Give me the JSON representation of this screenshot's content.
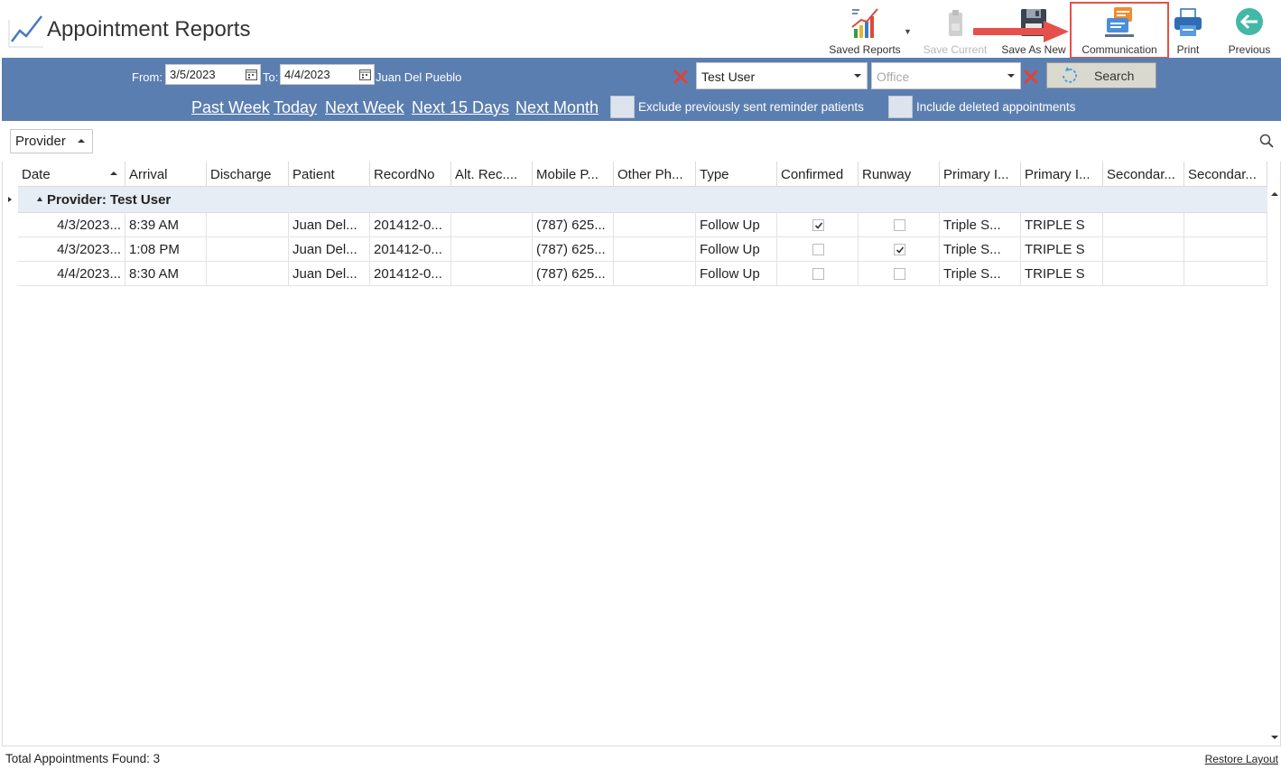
{
  "app": {
    "title": "Appointment Reports"
  },
  "toolbar": {
    "saved_reports": "Saved Reports",
    "save_current": "Save Current",
    "save_as_new": "Save As New",
    "communication": "Communication",
    "print": "Print",
    "previous": "Previous"
  },
  "filters": {
    "from_label": "From:",
    "from_value": "3/5/2023",
    "to_label": "To:",
    "to_value": "4/4/2023",
    "patient_name": "Juan Del Pueblo",
    "provider_value": "Test User",
    "office_placeholder": "Office",
    "search_label": "Search",
    "quick_links": [
      "Past Week",
      "Today",
      "Next Week",
      "Next 15 Days",
      "Next Month"
    ],
    "exclude_label": "Exclude previously sent reminder patients",
    "include_deleted_label": "Include deleted appointments"
  },
  "group_by": {
    "value": "Provider"
  },
  "grid": {
    "columns": [
      "Date",
      "Arrival",
      "Discharge",
      "Patient",
      "RecordNo",
      "Alt. Rec....",
      "Mobile P...",
      "Other Ph...",
      "Type",
      "Confirmed",
      "Runway",
      "Primary I...",
      "Primary I...",
      "Secondar...",
      "Secondar..."
    ],
    "group_label": "Provider: Test User",
    "rows": [
      {
        "date": "4/3/2023...",
        "arrival": "8:39 AM",
        "discharge": "",
        "patient": "Juan Del...",
        "record": "201412-0...",
        "alt": "",
        "mobile": "(787) 625...",
        "other": "",
        "type": "Follow Up",
        "confirmed": true,
        "runway": false,
        "prim1": "Triple S...",
        "prim2": "TRIPLE S",
        "sec1": "",
        "sec2": ""
      },
      {
        "date": "4/3/2023...",
        "arrival": "1:08 PM",
        "discharge": "",
        "patient": "Juan Del...",
        "record": "201412-0...",
        "alt": "",
        "mobile": "(787) 625...",
        "other": "",
        "type": "Follow Up",
        "confirmed": false,
        "runway": true,
        "prim1": "Triple S...",
        "prim2": "TRIPLE S",
        "sec1": "",
        "sec2": ""
      },
      {
        "date": "4/4/2023...",
        "arrival": "8:30 AM",
        "discharge": "",
        "patient": "Juan Del...",
        "record": "201412-0...",
        "alt": "",
        "mobile": "(787) 625...",
        "other": "",
        "type": "Follow Up",
        "confirmed": false,
        "runway": false,
        "prim1": "Triple S...",
        "prim2": "TRIPLE S",
        "sec1": "",
        "sec2": ""
      }
    ]
  },
  "footer": {
    "total": "Total Appointments Found: 3",
    "restore_layout": "Restore Layout"
  },
  "colors": {
    "filter_bar": "#5b7eb0",
    "highlight_border": "#e5514a",
    "group_row": "#e6edf5"
  }
}
